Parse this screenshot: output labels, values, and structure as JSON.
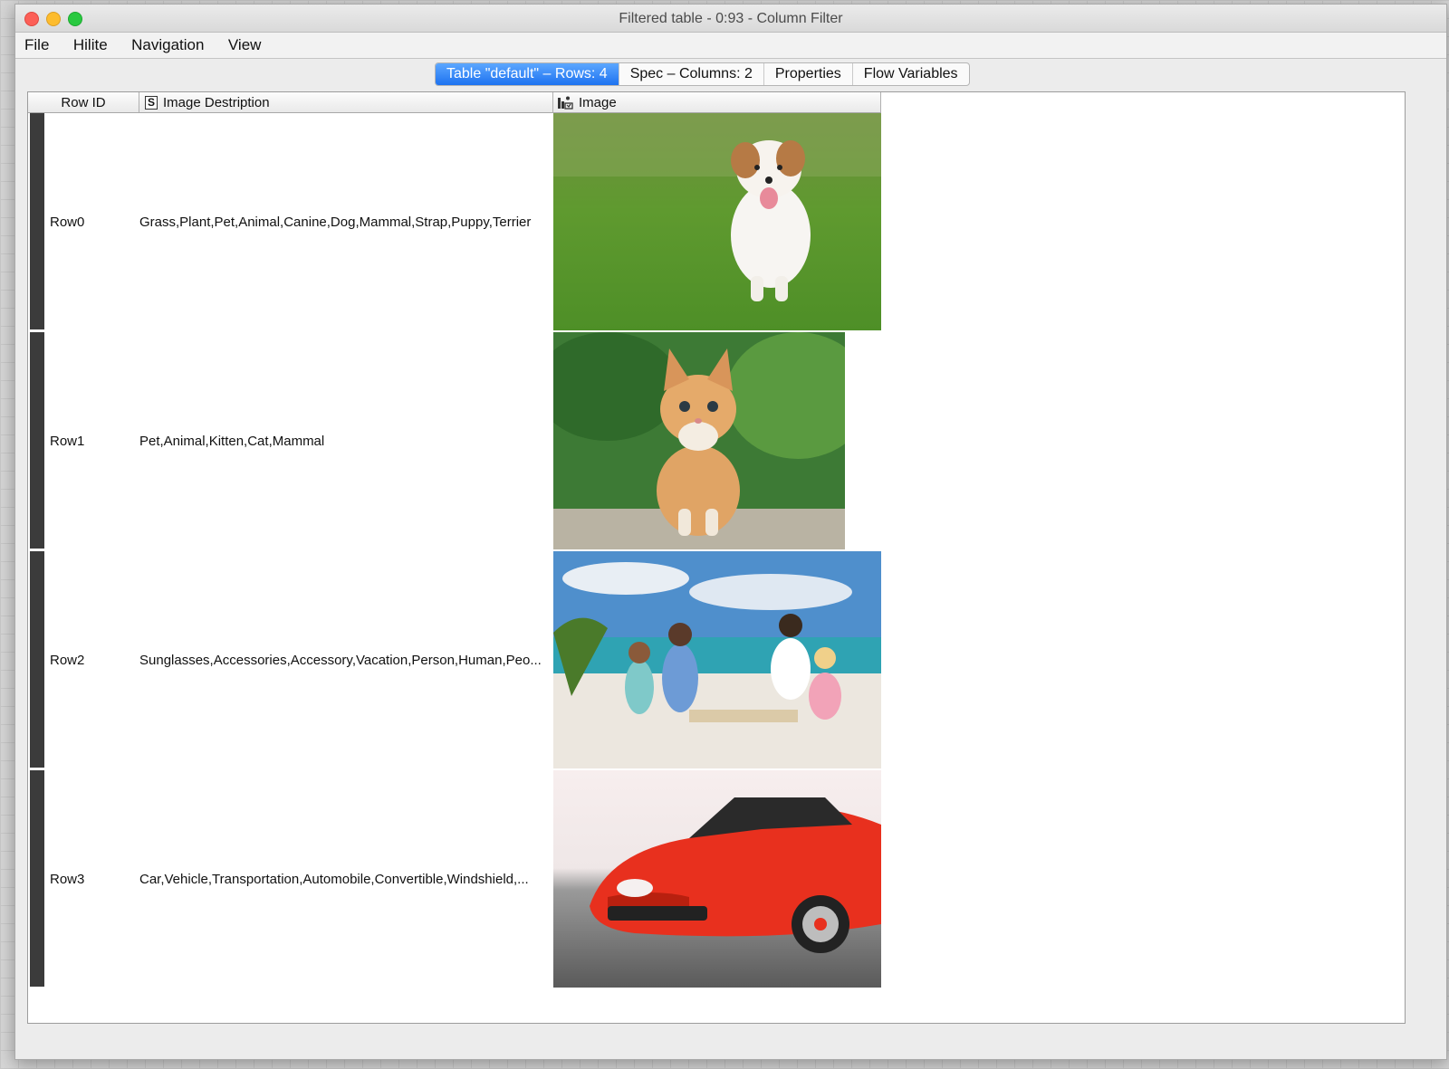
{
  "window": {
    "title": "Filtered table - 0:93 - Column Filter"
  },
  "menu": [
    "File",
    "Hilite",
    "Navigation",
    "View"
  ],
  "tabs": [
    {
      "label": "Table \"default\" – Rows: 4",
      "active": true
    },
    {
      "label": "Spec – Columns: 2",
      "active": false
    },
    {
      "label": "Properties",
      "active": false
    },
    {
      "label": "Flow Variables",
      "active": false
    }
  ],
  "table": {
    "columns": {
      "row_id": "Row ID",
      "description": "Image Destription",
      "image": "Image"
    },
    "column_types": {
      "description": "S",
      "image": "image-type-icon"
    },
    "rows": [
      {
        "id": "Row0",
        "description": "Grass,Plant,Pet,Animal,Canine,Dog,Mammal,Strap,Puppy,Terrier",
        "image": "puppy-photo"
      },
      {
        "id": "Row1",
        "description": "Pet,Animal,Kitten,Cat,Mammal",
        "image": "kitten-photo"
      },
      {
        "id": "Row2",
        "description": "Sunglasses,Accessories,Accessory,Vacation,Person,Human,Peo...",
        "image": "beach-family-photo"
      },
      {
        "id": "Row3",
        "description": "Car,Vehicle,Transportation,Automobile,Convertible,Windshield,...",
        "image": "red-convertible-photo"
      }
    ]
  }
}
